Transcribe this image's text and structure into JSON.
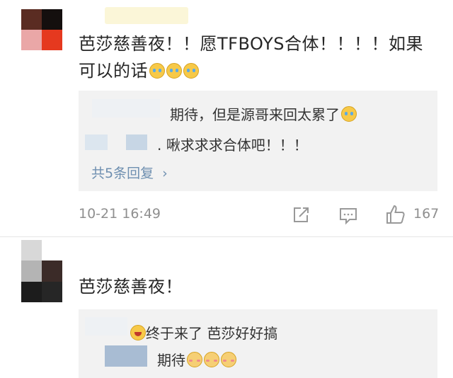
{
  "comment1": {
    "text": "芭莎慈善夜！！愿TFBOYS合体！！！！如果可以的话",
    "emojis": [
      "cry-emoji",
      "cry-emoji",
      "cry-emoji"
    ],
    "replies": [
      {
        "text": "期待，但是源哥来回太累了",
        "emoji": "cry-emoji"
      },
      {
        "text": ". 啾求求求合体吧！！！"
      }
    ],
    "more_replies": "共5条回复",
    "timestamp": "10-21 16:49",
    "likes": "167"
  },
  "comment2": {
    "text": "芭莎慈善夜！",
    "replies": [
      {
        "text": "终于来了 芭莎好好搞",
        "emoji": "laugh-emoji"
      },
      {
        "text": "期待",
        "emojis": [
          "shy-emoji",
          "shy-emoji",
          "shy-emoji"
        ]
      }
    ]
  },
  "colors": {
    "link": "#6e8fb0",
    "reply_bg": "#f2f2f2",
    "meta": "#8f8f8f"
  }
}
